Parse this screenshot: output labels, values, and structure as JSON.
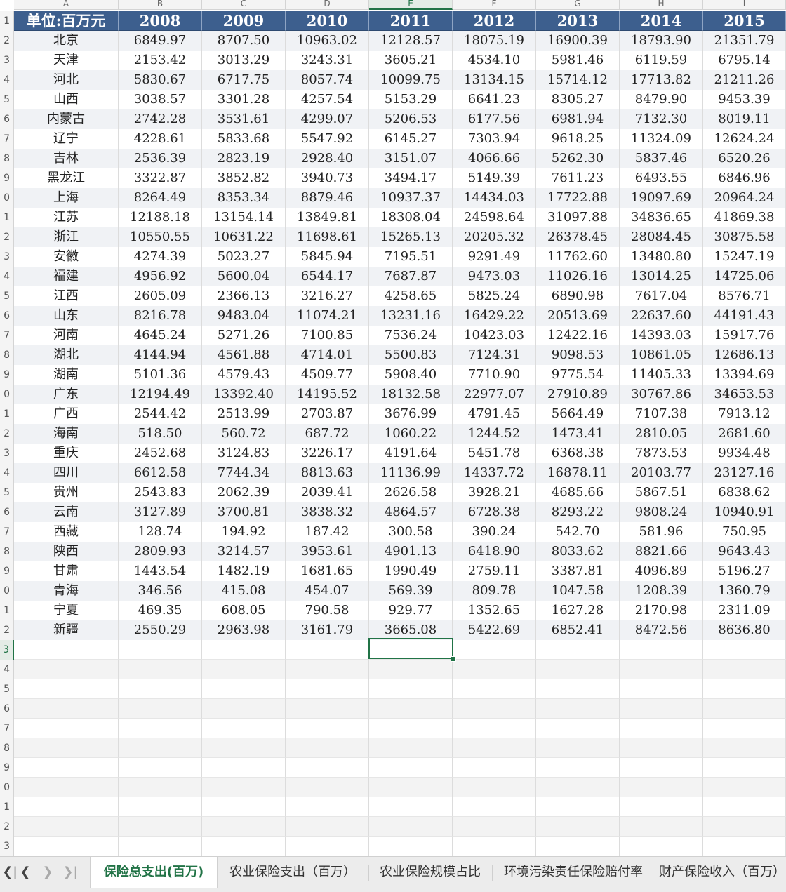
{
  "sheet": {
    "column_letters": [
      "A",
      "B",
      "C",
      "D",
      "E",
      "F",
      "G",
      "H",
      "I"
    ],
    "row_numbers_visible": [
      "1",
      "2",
      "3",
      "4",
      "5",
      "6",
      "7",
      "8",
      "9",
      "0",
      "1",
      "2",
      "3",
      "4",
      "5",
      "6",
      "7",
      "8",
      "9",
      "0",
      "1",
      "2",
      "3",
      "4",
      "5",
      "6",
      "7",
      "8",
      "9",
      "0",
      "1",
      "2",
      "3",
      "4",
      "5",
      "6",
      "7",
      "8",
      "9",
      "0",
      "1",
      "2",
      "3"
    ],
    "header": [
      "单位:百万元",
      "2008",
      "2009",
      "2010",
      "2011",
      "2012",
      "2013",
      "2014",
      "2015"
    ],
    "rows": [
      [
        "北京",
        "6849.97",
        "8707.50",
        "10963.02",
        "12128.57",
        "18075.19",
        "16900.39",
        "18793.90",
        "21351.79"
      ],
      [
        "天津",
        "2153.42",
        "3013.29",
        "3243.31",
        "3605.21",
        "4534.10",
        "5981.46",
        "6119.59",
        "6795.14"
      ],
      [
        "河北",
        "5830.67",
        "6717.75",
        "8057.74",
        "10099.75",
        "13134.15",
        "15714.12",
        "17713.82",
        "21211.26"
      ],
      [
        "山西",
        "3038.57",
        "3301.28",
        "4257.54",
        "5153.29",
        "6641.23",
        "8305.27",
        "8479.90",
        "9453.39"
      ],
      [
        "内蒙古",
        "2742.28",
        "3531.61",
        "4299.07",
        "5206.53",
        "6177.56",
        "6981.94",
        "7132.30",
        "8019.11"
      ],
      [
        "辽宁",
        "4228.61",
        "5833.68",
        "5547.92",
        "6145.27",
        "7303.94",
        "9618.25",
        "11324.09",
        "12624.24"
      ],
      [
        "吉林",
        "2536.39",
        "2823.19",
        "2928.40",
        "3151.07",
        "4066.66",
        "5262.30",
        "5837.46",
        "6520.26"
      ],
      [
        "黑龙江",
        "3322.87",
        "3852.82",
        "3940.73",
        "3494.17",
        "5149.39",
        "7611.23",
        "6493.55",
        "6846.96"
      ],
      [
        "上海",
        "8264.49",
        "8353.34",
        "8879.46",
        "10937.37",
        "14434.03",
        "17722.88",
        "19097.69",
        "20964.24"
      ],
      [
        "江苏",
        "12188.18",
        "13154.14",
        "13849.81",
        "18308.04",
        "24598.64",
        "31097.88",
        "34836.65",
        "41869.38"
      ],
      [
        "浙江",
        "10550.55",
        "10631.22",
        "11698.61",
        "15265.13",
        "20205.32",
        "26378.45",
        "28084.45",
        "30875.58"
      ],
      [
        "安徽",
        "4274.39",
        "5023.27",
        "5845.94",
        "7195.51",
        "9291.49",
        "11762.60",
        "13480.80",
        "15247.19"
      ],
      [
        "福建",
        "4956.92",
        "5600.04",
        "6544.17",
        "7687.87",
        "9473.03",
        "11026.16",
        "13014.25",
        "14725.06"
      ],
      [
        "江西",
        "2605.09",
        "2366.13",
        "3216.27",
        "4258.65",
        "5825.24",
        "6890.98",
        "7617.04",
        "8576.71"
      ],
      [
        "山东",
        "8216.78",
        "9483.04",
        "11074.21",
        "13231.16",
        "16429.22",
        "20513.69",
        "22637.60",
        "44191.43"
      ],
      [
        "河南",
        "4645.24",
        "5271.26",
        "7100.85",
        "7536.24",
        "10423.03",
        "12422.16",
        "14393.03",
        "15917.76"
      ],
      [
        "湖北",
        "4144.94",
        "4561.88",
        "4714.01",
        "5500.83",
        "7124.31",
        "9098.53",
        "10861.05",
        "12686.13"
      ],
      [
        "湖南",
        "5101.36",
        "4579.43",
        "4509.77",
        "5908.40",
        "7710.90",
        "9775.54",
        "11405.33",
        "13394.69"
      ],
      [
        "广东",
        "12194.49",
        "13392.40",
        "14195.52",
        "18132.58",
        "22977.07",
        "27910.89",
        "30767.86",
        "34653.53"
      ],
      [
        "广西",
        "2544.42",
        "2513.99",
        "2703.87",
        "3676.99",
        "4791.45",
        "5664.49",
        "7107.38",
        "7913.12"
      ],
      [
        "海南",
        "518.50",
        "560.72",
        "687.72",
        "1060.22",
        "1244.52",
        "1473.41",
        "2810.05",
        "2681.60"
      ],
      [
        "重庆",
        "2452.68",
        "3124.83",
        "3226.17",
        "4191.64",
        "5451.78",
        "6368.38",
        "7873.53",
        "9934.48"
      ],
      [
        "四川",
        "6612.58",
        "7744.34",
        "8813.63",
        "11136.99",
        "14337.72",
        "16878.11",
        "20103.77",
        "23127.16"
      ],
      [
        "贵州",
        "2543.83",
        "2062.39",
        "2039.41",
        "2626.58",
        "3928.21",
        "4685.66",
        "5867.51",
        "6838.62"
      ],
      [
        "云南",
        "3127.89",
        "3700.81",
        "3838.32",
        "4864.57",
        "6728.38",
        "8293.22",
        "9808.24",
        "10940.91"
      ],
      [
        "西藏",
        "128.74",
        "194.92",
        "187.42",
        "300.58",
        "390.24",
        "542.70",
        "581.96",
        "750.95"
      ],
      [
        "陕西",
        "2809.93",
        "3214.57",
        "3953.61",
        "4901.13",
        "6418.90",
        "8033.62",
        "8821.66",
        "9643.43"
      ],
      [
        "甘肃",
        "1443.54",
        "1482.19",
        "1681.65",
        "1990.49",
        "2759.11",
        "3387.81",
        "4096.89",
        "5196.27"
      ],
      [
        "青海",
        "346.56",
        "415.08",
        "454.07",
        "569.39",
        "809.78",
        "1047.58",
        "1208.39",
        "1360.79"
      ],
      [
        "宁夏",
        "469.35",
        "608.05",
        "790.58",
        "929.77",
        "1352.65",
        "1627.28",
        "2170.98",
        "2311.09"
      ],
      [
        "新疆",
        "2550.29",
        "2963.98",
        "3161.79",
        "3665.08",
        "5422.69",
        "6852.41",
        "8472.56",
        "8636.80"
      ]
    ]
  },
  "tabs": {
    "nav_icons": [
      "first-sheet-icon",
      "prev-sheet-icon",
      "next-sheet-icon",
      "last-sheet-icon"
    ],
    "nav_glyphs": [
      "❮|",
      "❮",
      "❯",
      "❯|"
    ],
    "items": [
      {
        "label": "保险总支出(百万)",
        "active": true
      },
      {
        "label": "农业保险支出（百万）",
        "active": false
      },
      {
        "label": "农业保险规模占比",
        "active": false
      },
      {
        "label": "环境污染责任保险赔付率",
        "active": false
      },
      {
        "label": "财产保险收入（百万）",
        "active": false
      }
    ]
  },
  "colors": {
    "header_bg": "#3d5f8e",
    "accent": "#217346",
    "alt_row": "#f0f2f5"
  }
}
